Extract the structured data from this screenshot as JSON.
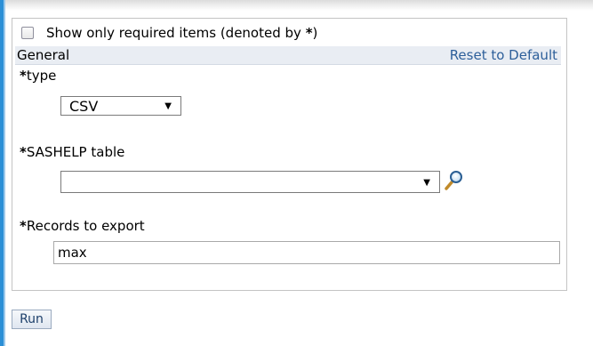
{
  "options": {
    "show_required_prefix": "Show only required items (denoted by ",
    "show_required_asterisk": "*",
    "show_required_suffix": ")",
    "show_required_checked": false
  },
  "section": {
    "title": "General",
    "reset_label": "Reset to Default"
  },
  "fields": {
    "type": {
      "asterisk": "*",
      "label": "type",
      "value": "CSV"
    },
    "sashelp_table": {
      "asterisk": "*",
      "label": "SASHELP table",
      "value": ""
    },
    "records": {
      "asterisk": "*",
      "label": "Records to export",
      "value": "max"
    }
  },
  "actions": {
    "run_label": "Run"
  },
  "icons": {
    "dropdown": "chevron-down-icon",
    "search": "search-icon"
  },
  "colors": {
    "accent": "#2b8fd6",
    "link": "#2d5f9a",
    "section_header_bg": "#e9edf3"
  }
}
